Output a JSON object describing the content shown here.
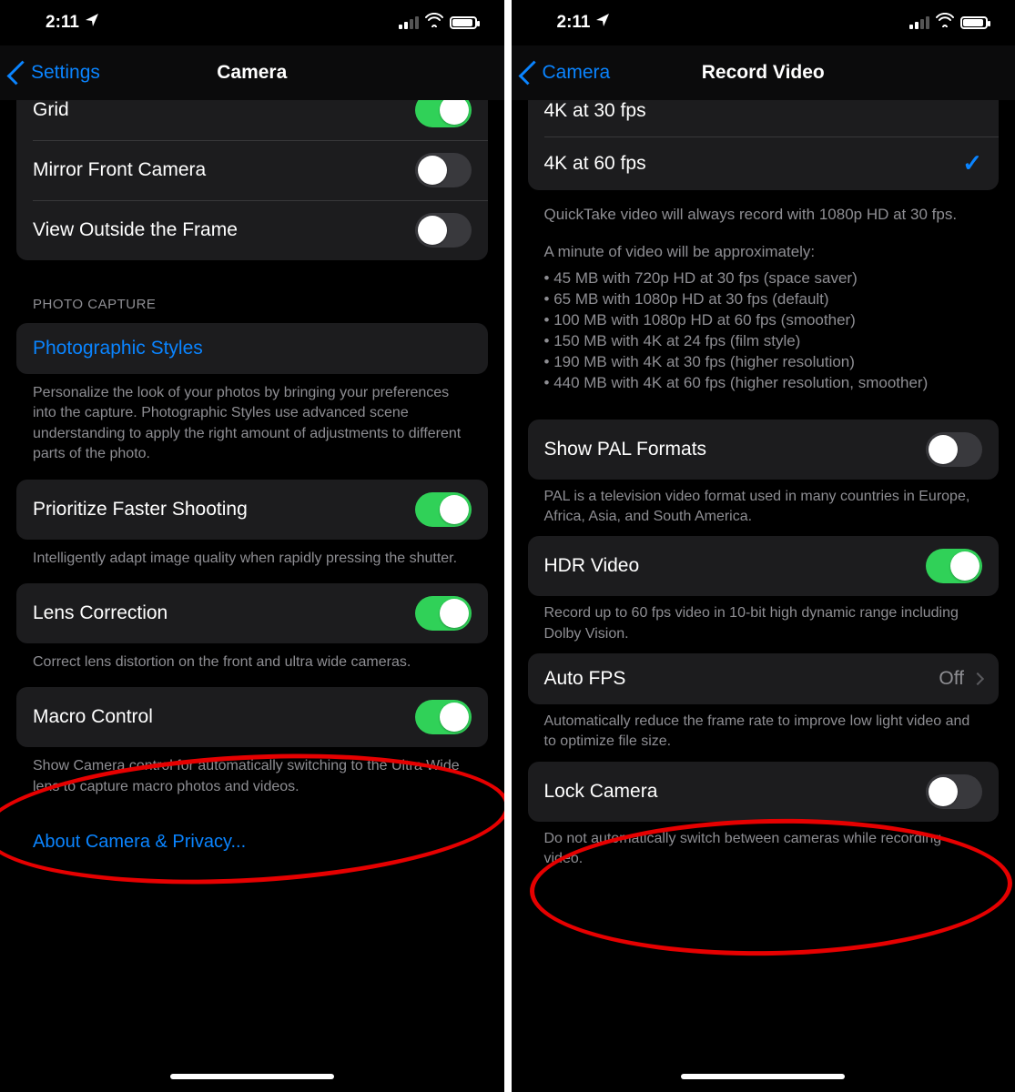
{
  "left": {
    "status": {
      "time": "2:11"
    },
    "nav": {
      "back": "Settings",
      "title": "Camera"
    },
    "top_rows": [
      {
        "label": "Grid",
        "on": true
      },
      {
        "label": "Mirror Front Camera",
        "on": false
      },
      {
        "label": "View Outside the Frame",
        "on": false
      }
    ],
    "photo_capture_header": "Photo Capture",
    "photographic_styles": "Photographic Styles",
    "photographic_desc": "Personalize the look of your photos by bringing your preferences into the capture. Photographic Styles use advanced scene understanding to apply the right amount of adjustments to different parts of the photo.",
    "prioritize": {
      "label": "Prioritize Faster Shooting",
      "on": true
    },
    "prioritize_desc": "Intelligently adapt image quality when rapidly pressing the shutter.",
    "lens": {
      "label": "Lens Correction",
      "on": true
    },
    "lens_desc": "Correct lens distortion on the front and ultra wide cameras.",
    "macro": {
      "label": "Macro Control",
      "on": true
    },
    "macro_desc": "Show Camera control for automatically switching to the Ultra Wide lens to capture macro photos and videos.",
    "about_link": "About Camera & Privacy..."
  },
  "right": {
    "status": {
      "time": "2:11"
    },
    "nav": {
      "back": "Camera",
      "title": "Record Video"
    },
    "options": [
      {
        "label": "4K at 30 fps",
        "selected": false
      },
      {
        "label": "4K at 60 fps",
        "selected": true
      }
    ],
    "quicktake": "QuickTake video will always record with 1080p HD at 30 fps.",
    "minute_intro": "A minute of video will be approximately:",
    "minute_lines": [
      "45 MB with 720p HD at 30 fps (space saver)",
      "65 MB with 1080p HD at 30 fps (default)",
      "100 MB with 1080p HD at 60 fps (smoother)",
      "150 MB with 4K at 24 fps (film style)",
      "190 MB with 4K at 30 fps (higher resolution)",
      "440 MB with 4K at 60 fps (higher resolution, smoother)"
    ],
    "pal": {
      "label": "Show PAL Formats",
      "on": false
    },
    "pal_desc": "PAL is a television video format used in many countries in Europe, Africa, Asia, and South America.",
    "hdr": {
      "label": "HDR Video",
      "on": true
    },
    "hdr_desc": "Record up to 60 fps video in 10-bit high dynamic range including Dolby Vision.",
    "autofps": {
      "label": "Auto FPS",
      "value": "Off"
    },
    "autofps_desc": "Automatically reduce the frame rate to improve low light video and to optimize file size.",
    "lock": {
      "label": "Lock Camera",
      "on": false
    },
    "lock_desc": "Do not automatically switch between cameras while recording video."
  }
}
